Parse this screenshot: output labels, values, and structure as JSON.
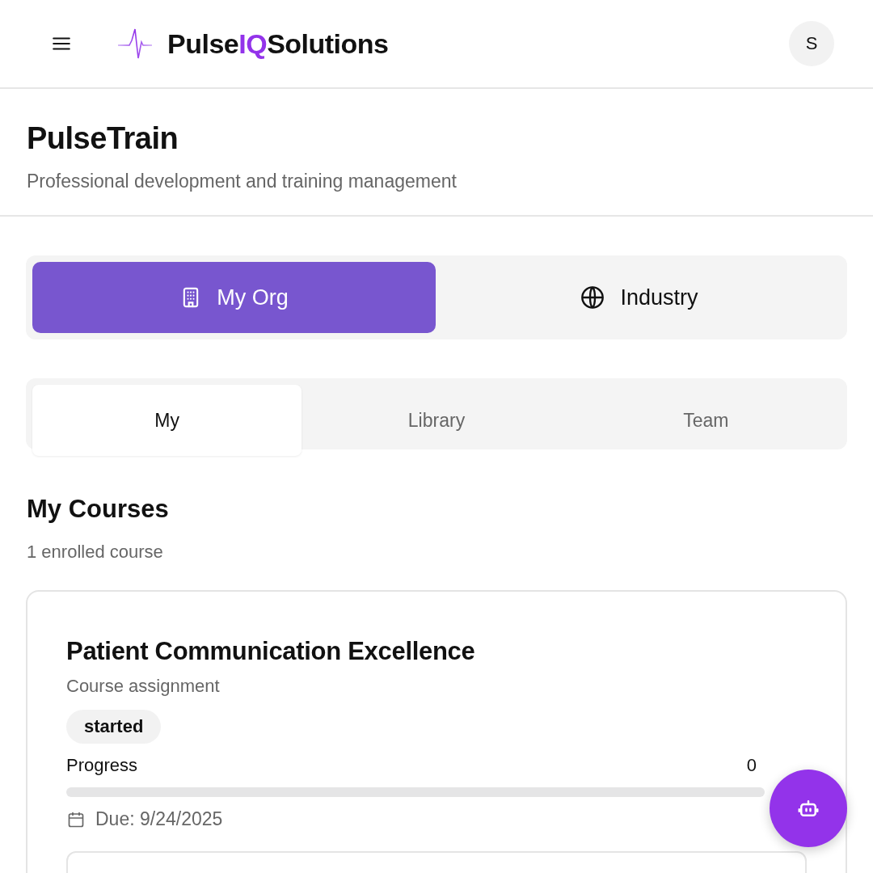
{
  "header": {
    "brand": {
      "prefix": "Pulse",
      "highlight": "IQ",
      "suffix": "Solutions"
    },
    "avatar": "S"
  },
  "page": {
    "title": "PulseTrain",
    "subtitle": "Professional development and training management"
  },
  "scopes": [
    {
      "label": "My Org",
      "kind": "building",
      "selected": true
    },
    {
      "label": "Industry",
      "kind": "globe",
      "selected": false
    }
  ],
  "tabs": [
    {
      "label": "My",
      "selected": true
    },
    {
      "label": "Library",
      "selected": false
    },
    {
      "label": "Team",
      "selected": false
    }
  ],
  "section": {
    "title": "My Courses",
    "count": "1 enrolled course"
  },
  "courses": [
    {
      "title": "Patient Communication Excellence",
      "type": "Course assignment",
      "status": "started",
      "progress_label": "Progress",
      "reading": "0",
      "level": 0,
      "due": "Due: 9/24/2025"
    }
  ]
}
